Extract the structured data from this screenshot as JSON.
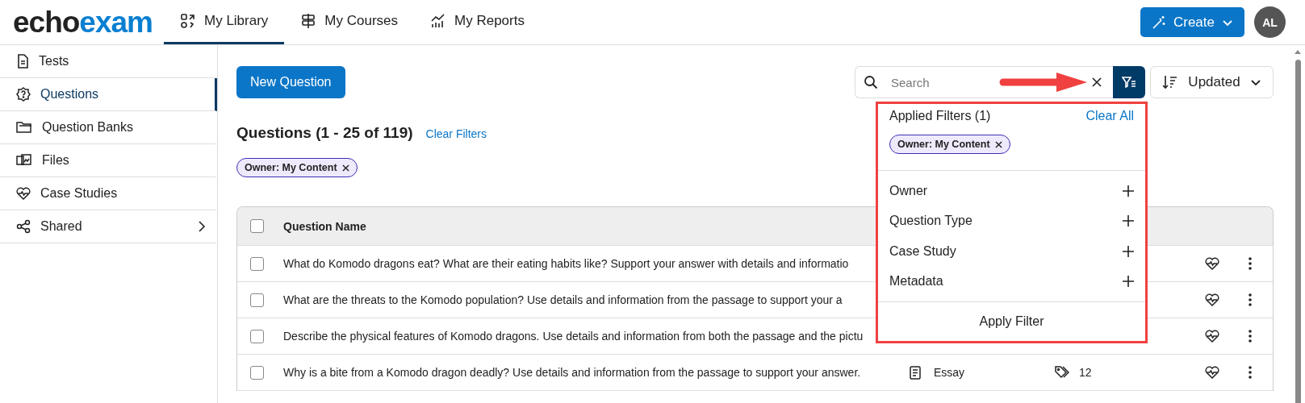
{
  "header": {
    "logo": [
      "echo",
      "exam"
    ],
    "tabs": [
      {
        "label": "My Library",
        "selected": true
      },
      {
        "label": "My Courses",
        "selected": false
      },
      {
        "label": "My Reports",
        "selected": false
      }
    ],
    "create_button": "Create",
    "avatar": "AL"
  },
  "sidebar": {
    "items": [
      {
        "label": "Tests",
        "selected": false,
        "expandable": false
      },
      {
        "label": "Questions",
        "selected": true,
        "expandable": false
      },
      {
        "label": "Question Banks",
        "selected": false,
        "expandable": false
      },
      {
        "label": "Files",
        "selected": false,
        "expandable": false
      },
      {
        "label": "Case Studies",
        "selected": false,
        "expandable": false
      },
      {
        "label": "Shared",
        "selected": false,
        "expandable": true
      }
    ]
  },
  "toolbar": {
    "new_button": "New Question",
    "search": {
      "placeholder": "Search"
    },
    "sort": "Updated"
  },
  "heading": "Questions (1 - 25 of 119)",
  "clear_filters": "Clear Filters",
  "chips": [
    "Owner: My Content"
  ],
  "table": {
    "select_all_checked": false,
    "columns": [
      "Question Name"
    ],
    "rows": [
      {
        "checked": false,
        "question": "What do Komodo dragons eat? What are their eating habits like? Support your answer with details and informatio"
      },
      {
        "checked": false,
        "question": "What are the threats to the Komodo population? Use details and information from the passage to support your a"
      },
      {
        "checked": false,
        "question": "Describe the physical features of Komodo dragons. Use details and information from both the passage and the pictu"
      },
      {
        "checked": false,
        "question": "Why is a bite from a Komodo dragon deadly? Use details and information from the passage to support your answer.",
        "type": "Essay",
        "tags": "12"
      }
    ]
  },
  "filter_panel": {
    "title": "Applied Filters (1)",
    "clear_all": "Clear All",
    "chips": [
      "Owner: My Content"
    ],
    "sections": [
      "Owner",
      "Question Type",
      "Case Study",
      "Metadata"
    ],
    "apply_button": "Apply Filter"
  }
}
